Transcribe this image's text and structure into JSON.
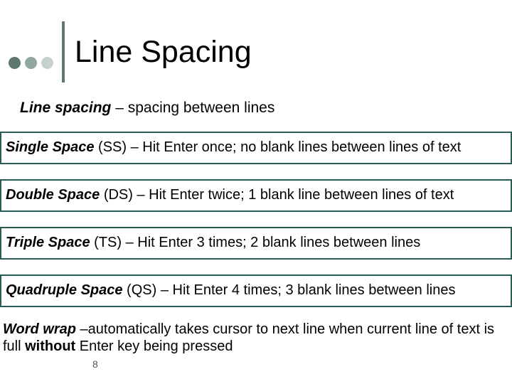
{
  "colors": {
    "dot1": "#5f786f",
    "dot2": "#90a79e",
    "dot3": "#c6d1cc",
    "bar": "#5f786f",
    "box_border": "#2a5c56"
  },
  "title": "Line Spacing",
  "subtitle": {
    "term": "Line spacing",
    "rest": " – spacing between lines"
  },
  "boxes": [
    {
      "term": "Single Space",
      "abbrev": " (SS) – ",
      "rest": "Hit Enter once; no blank lines between lines of text"
    },
    {
      "term": "Double Space",
      "abbrev": " (DS) – ",
      "rest": "Hit Enter twice; 1 blank line between lines of text"
    },
    {
      "term": "Triple Space",
      "abbrev": " (TS) – ",
      "rest": "Hit Enter 3 times; 2 blank lines between lines"
    },
    {
      "term": "Quadruple Space",
      "abbrev": " (QS) – ",
      "rest": "Hit Enter 4 times; 3 blank lines between lines"
    }
  ],
  "footer": {
    "term": "Word wrap",
    "mid1": " –automatically takes cursor to next line when current line of text is full ",
    "kw": "without",
    "mid2": " Enter key being pressed"
  },
  "page_number": "8"
}
